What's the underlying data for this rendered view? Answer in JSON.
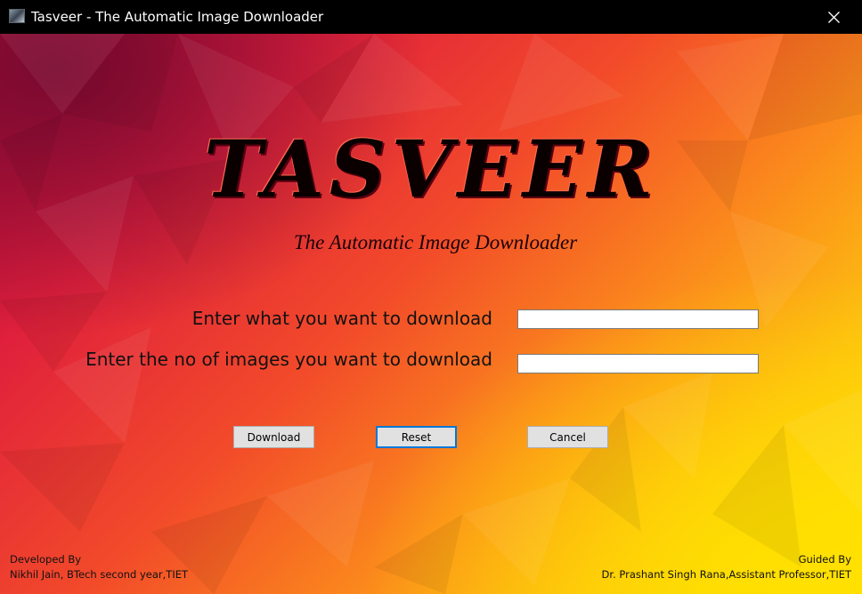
{
  "window": {
    "title": "Tasveer - The Automatic Image Downloader"
  },
  "header": {
    "logo": "TASVEER",
    "subtitle": "The Automatic Image Downloader"
  },
  "form": {
    "query_label": "Enter what you want to download",
    "query_value": "",
    "count_label": "Enter the no of images you want to download",
    "count_value": ""
  },
  "buttons": {
    "download": "Download",
    "reset": "Reset",
    "cancel": "Cancel"
  },
  "footer": {
    "developed_heading": "Developed By",
    "developer": "Nikhil Jain, BTech second year,TIET",
    "guided_heading": "Guided By",
    "guide": "Dr. Prashant Singh Rana,Assistant Professor,TIET"
  },
  "icons": {
    "app": "app-icon",
    "close": "close-icon"
  },
  "colors": {
    "titlebar": "#000000",
    "focus_border": "#0078d7"
  }
}
